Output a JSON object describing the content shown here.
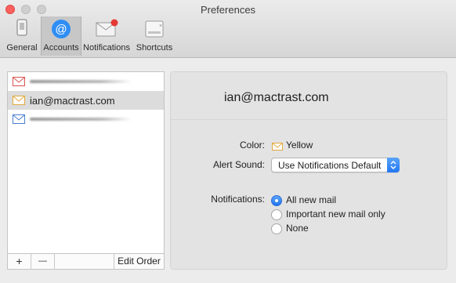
{
  "window": {
    "title": "Preferences"
  },
  "toolbar": {
    "items": [
      {
        "label": "General",
        "icon": "phone-icon"
      },
      {
        "label": "Accounts",
        "icon": "at-sign-icon",
        "selected": true
      },
      {
        "label": "Notifications",
        "icon": "envelope-badge-icon"
      },
      {
        "label": "Shortcuts",
        "icon": "keyboard-icon"
      }
    ]
  },
  "accounts": {
    "rows": [
      {
        "name": "",
        "color": "#d9534f",
        "redacted": true
      },
      {
        "name": "ian@mactrast.com",
        "color": "#e2a83a",
        "selected": true
      },
      {
        "name": "",
        "color": "#4a7ed1",
        "redacted": true
      }
    ],
    "add_label": "+",
    "remove_label": "—",
    "edit_order_label": "Edit Order"
  },
  "detail": {
    "email": "ian@mactrast.com",
    "color_label": "Color:",
    "color_value": "Yellow",
    "color_hex": "#e2a83a",
    "alert_label": "Alert Sound:",
    "alert_value": "Use Notifications Default",
    "notifications_label": "Notifications:",
    "options": [
      {
        "label": "All new mail",
        "checked": true
      },
      {
        "label": "Important new mail only",
        "checked": false
      },
      {
        "label": "None",
        "checked": false
      }
    ]
  },
  "colors": {
    "accent": "#2176f1",
    "close": "#fc605c"
  }
}
